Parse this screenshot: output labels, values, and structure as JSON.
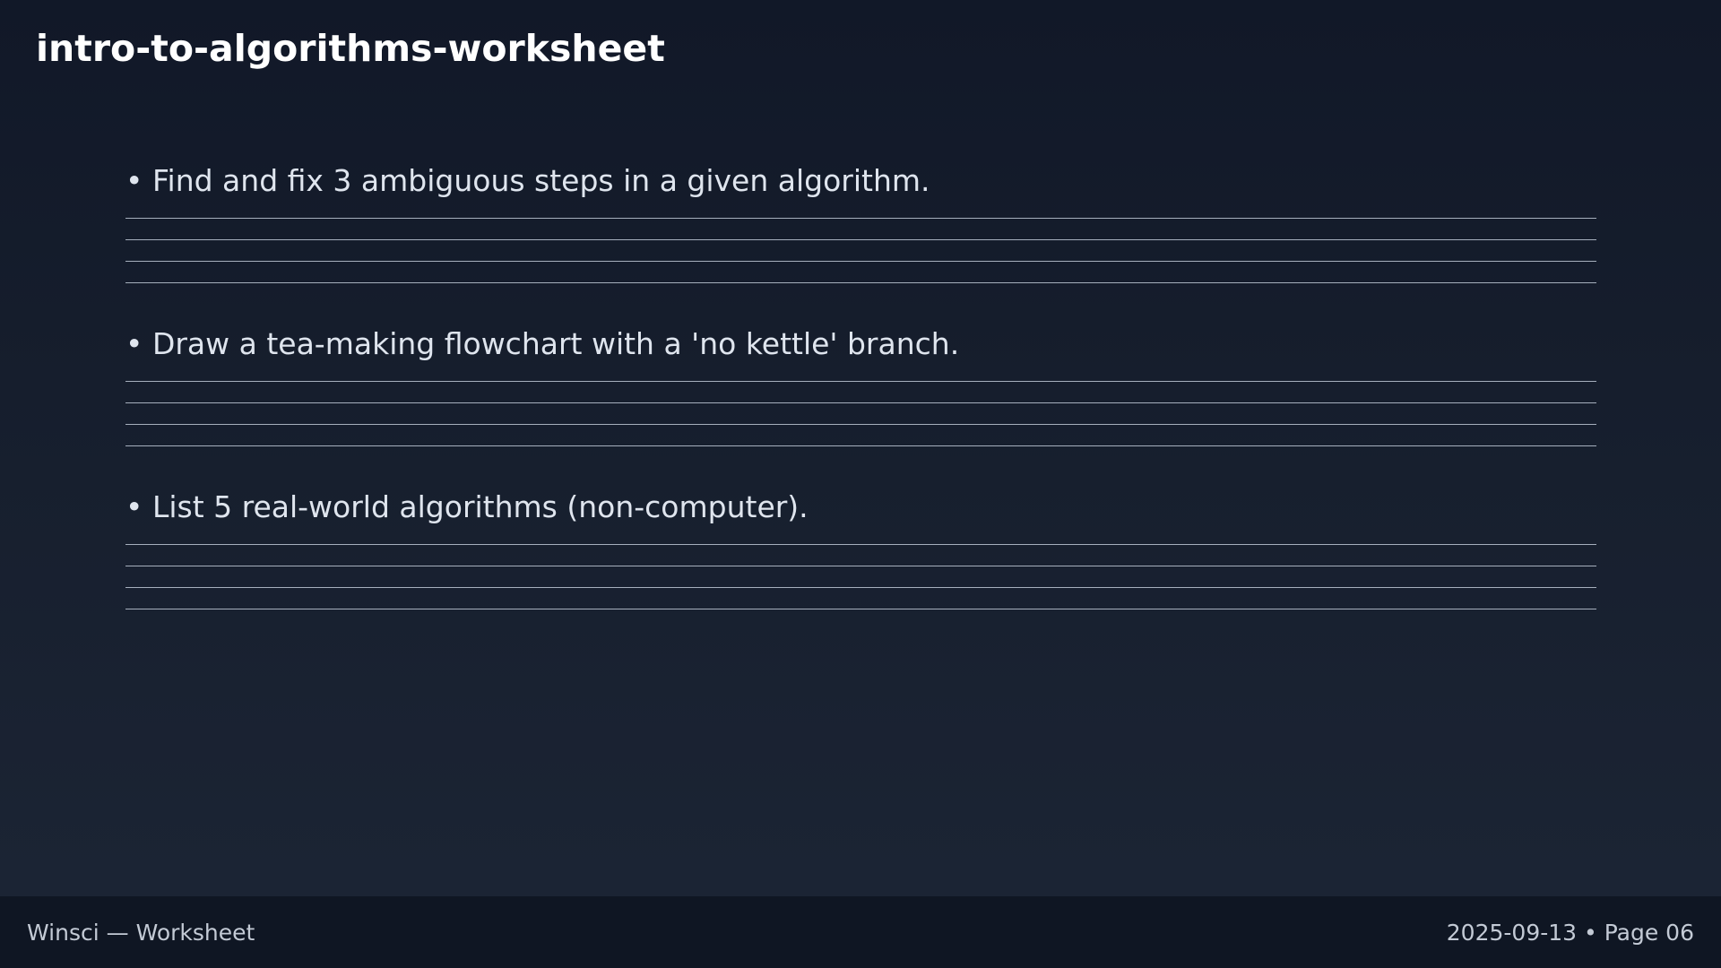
{
  "page": {
    "title": "intro-to-algorithms-worksheet"
  },
  "items": [
    "• Find and fix 3 ambiguous steps in a given algorithm.",
    "• Draw a tea-making flowchart with a 'no kettle' branch.",
    "• List 5 real-world algorithms (non-computer)."
  ],
  "footer": {
    "left": "Winsci — Worksheet",
    "right": "2025-09-13 • Page 06"
  }
}
